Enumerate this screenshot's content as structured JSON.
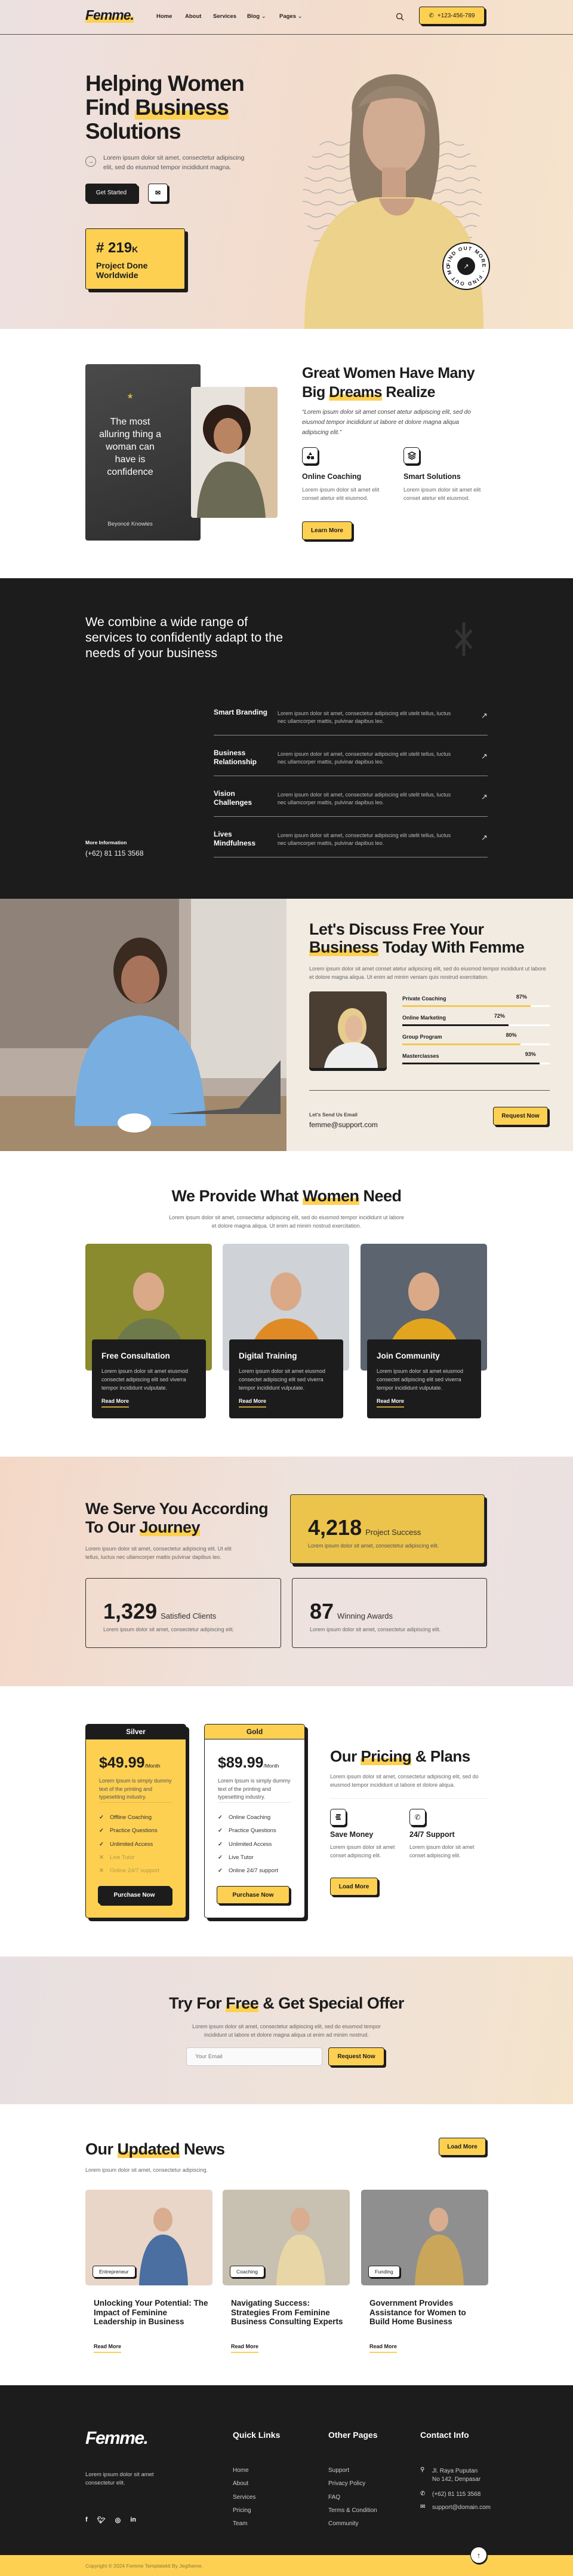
{
  "colors": {
    "accent": "#fdd052",
    "dark": "#1c1c1c",
    "cream": "#f2ebe2"
  },
  "nav": {
    "logo": "Femme.",
    "items": [
      "Home",
      "About",
      "Services",
      "Blog",
      "Pages"
    ],
    "phone": "+123-456-789",
    "search_icon": "search-icon"
  },
  "hero": {
    "title_1": "Helping Women",
    "title_2a": "Find ",
    "title_2b": "Business",
    "title_3": "Solutions",
    "text": "Lorem ipsum dolor sit amet, consectetur adipiscing elit, sed do eiusmod tempor incididunt magna.",
    "get_started": "Get Started",
    "stat_value": "# 219",
    "stat_suffix": "K",
    "stat_label": "Project Done Worldwide",
    "badge": "FIND OUT MORE · FIND OUT MORE ·"
  },
  "about": {
    "card_quote": "The most alluring thing a woman can have is confidence",
    "card_author": "Beyoncé Knowles",
    "title_a": "Great Women Have Many Big ",
    "title_hl": "Dreams",
    "title_b": " Realize",
    "quote": "“Lorem ipsum dolor sit amet conset atetur adipiscing elit, sed do eiusmod tempor incididunt ut labore et dolore magna aliqua adipiscing elit.”",
    "features": [
      {
        "title": "Online Coaching",
        "text": "Lorem ipsum dolor sit amet elit conset atetur elit eiusmod."
      },
      {
        "title": "Smart Solutions",
        "text": "Lorem ipsum dolor sit amet elit conset atetur elit eiusmod."
      }
    ],
    "button": "Learn More"
  },
  "services": {
    "heading": "We combine a wide range of services to confidently adapt to the needs of your business",
    "rows": [
      {
        "title": "Smart Branding",
        "text": "Lorem ipsum dolor sit amet, consectetur adipiscing elit utelit tellus, luctus nec ullamcorper mattis, pulvinar dapibus leo."
      },
      {
        "title": "Business Relationship",
        "text": "Lorem ipsum dolor sit amet, consectetur adipiscing elit utelit tellus, luctus nec ullamcorper mattis, pulvinar dapibus leo."
      },
      {
        "title": "Vision Challenges",
        "text": "Lorem ipsum dolor sit amet, consectetur adipiscing elit utelit tellus, luctus nec ullamcorper mattis, pulvinar dapibus leo."
      },
      {
        "title": "Lives Mindfulness",
        "text": "Lorem ipsum dolor sit amet, consectetur adipiscing elit utelit tellus, luctus nec ullamcorper mattis, pulvinar dapibus leo."
      }
    ],
    "more_label": "More Information",
    "phone": "(+62) 81 115 3568"
  },
  "discuss": {
    "title_a": "Let's Discuss Free Your ",
    "title_hl": "Business",
    "title_b": " Today With Femme",
    "text": "Lorem ipsum dolor sit amet conset atetur adipiscing elit, sed do eiusmod tempor incididunt ut labore et dolore magna aliqua. Ut enim ad minim veniam quis nostrud exercitation.",
    "skills": [
      {
        "label": "Private Coaching",
        "percent": "87%"
      },
      {
        "label": "Online Marketing",
        "percent": "72%"
      },
      {
        "label": "Group Program",
        "percent": "80%"
      },
      {
        "label": "Masterclasses",
        "percent": "93%"
      }
    ],
    "email_label": "Let's Send Us Email",
    "email": "femme@support.com",
    "button": "Request Now"
  },
  "provide": {
    "title_a": "We Provide What ",
    "title_hl": "Women",
    "title_b": " Need",
    "text": "Lorem ipsum dolor sit amet, consectetur adipiscing elit, sed do eiusmod tempor incididunt ut labore et dolore magna aliqua. Ut enim ad minim nostrud exercitation.",
    "cards": [
      {
        "title": "Free Consultation",
        "text": "Lorem ipsum dolor sit amet eiusmod consectet adipiscing elit sed viverra tempor incididunt vulputate.",
        "link": "Read More"
      },
      {
        "title": "Digital Training",
        "text": "Lorem ipsum dolor sit amet eiusmod consectet adipiscing elit sed viverra tempor incididunt vulputate.",
        "link": "Read More"
      },
      {
        "title": "Join Community",
        "text": "Lorem ipsum dolor sit amet eiusmod consectet adipiscing elit sed viverra tempor incididunt vulputate.",
        "link": "Read More"
      }
    ]
  },
  "journey": {
    "title_a": "We Serve You According To Our ",
    "title_hl": "Journey",
    "text": "Lorem ipsum dolor sit amet, consectetur adipiscing elit. Ut elit tellus, luctus nec ullamcorper mattis pulvinar dapibus leo.",
    "stats": [
      {
        "value": "4,218",
        "label": "Project Success",
        "text": "Lorem ipsum dolor sit amet, consectetur adipiscing elit."
      },
      {
        "value": "1,329",
        "label": "Satisfied Clients",
        "text": "Lorem ipsum dolor sit amet, consectetur adipiscing elit."
      },
      {
        "value": "87",
        "label": "Winning Awards",
        "text": "Lorem ipsum dolor sit amet, consectetur adipiscing elit."
      }
    ]
  },
  "pricing": {
    "plans": [
      {
        "name": "Silver",
        "price": "$49.99",
        "period": "/Month",
        "text": "Lorem Ipsum is simply dummy text of the printing and typesetting industry.",
        "features": [
          {
            "label": "Offline Coaching",
            "included": true
          },
          {
            "label": "Practice Questions",
            "included": true
          },
          {
            "label": "Unlimited Access",
            "included": true
          },
          {
            "label": "Live Tutor",
            "included": false
          },
          {
            "label": "Online 24/7 support",
            "included": false
          }
        ],
        "button": "Purchase Now"
      },
      {
        "name": "Gold",
        "price": "$89.99",
        "period": "/Month",
        "text": "Lorem Ipsum is simply dummy text of the printing and typesetting industry.",
        "features": [
          {
            "label": "Online Coaching",
            "included": true
          },
          {
            "label": "Practice Questions",
            "included": true
          },
          {
            "label": "Unlimited Access",
            "included": true
          },
          {
            "label": "Live Tutor",
            "included": true
          },
          {
            "label": "Online 24/7 support",
            "included": true
          }
        ],
        "button": "Purchase Now"
      }
    ],
    "title_a": "Our ",
    "title_hl": "Pricing",
    "title_b": " & Plans",
    "text": "Lorem ipsum dolor sit amet, consectetur adipiscing elit, sed do eiusmod tempor incididunt ut labore et dolore aliqua.",
    "features": [
      {
        "title": "Save Money",
        "text": "Lorem ipsum dolor sit amet conset adipiscing elit."
      },
      {
        "title": "24/7 Support",
        "text": "Lorem ipsum dolor sit amet conset adipiscing elit."
      }
    ],
    "button": "Load More"
  },
  "offer": {
    "title_a": "Try For ",
    "title_hl": "Free",
    "title_b": " & Get Special Offer",
    "text": "Lorem ipsum dolor sit amet, consectetur adipiscing elit, sed do eiusmod tempor incididunt ut labore et dolore magna aliqua ut enim ad minim nostrud.",
    "placeholder": "Your Email",
    "button": "Request Now"
  },
  "news": {
    "title_a": "Our ",
    "title_hl": "Updated",
    "title_b": " News",
    "text": "Lorem ipsum dolor sit amet, consectetur adipiscing.",
    "button": "Load More",
    "posts": [
      {
        "tag": "Entrepreneur",
        "title": "Unlocking Your Potential: The Impact of Feminine Leadership in Business",
        "link": "Read More"
      },
      {
        "tag": "Coaching",
        "title": "Navigating Success: Strategies From Feminine Business Consulting Experts",
        "link": "Read More"
      },
      {
        "tag": "Funding",
        "title": "Government Provides Assistance for Women to Build Home Business",
        "link": "Read More"
      }
    ]
  },
  "footer": {
    "logo": "Femme.",
    "text": "Lorem ipsum dolor sit amet consectetur elit.",
    "quick_title": "Quick Links",
    "quick_links": [
      "Home",
      "About",
      "Services",
      "Pricing",
      "Team"
    ],
    "other_title": "Other Pages",
    "other_links": [
      "Support",
      "Privacy Policy",
      "FAQ",
      "Terms & Condition",
      "Community"
    ],
    "contact_title": "Contact Info",
    "address": "Jl. Raya Puputan No 142, Denpasar",
    "phone": "(+62) 81 115 3568",
    "email": "support@domain.com",
    "copyright": "Copyright © 2024 Femme Templatekit By Jegtheme."
  }
}
